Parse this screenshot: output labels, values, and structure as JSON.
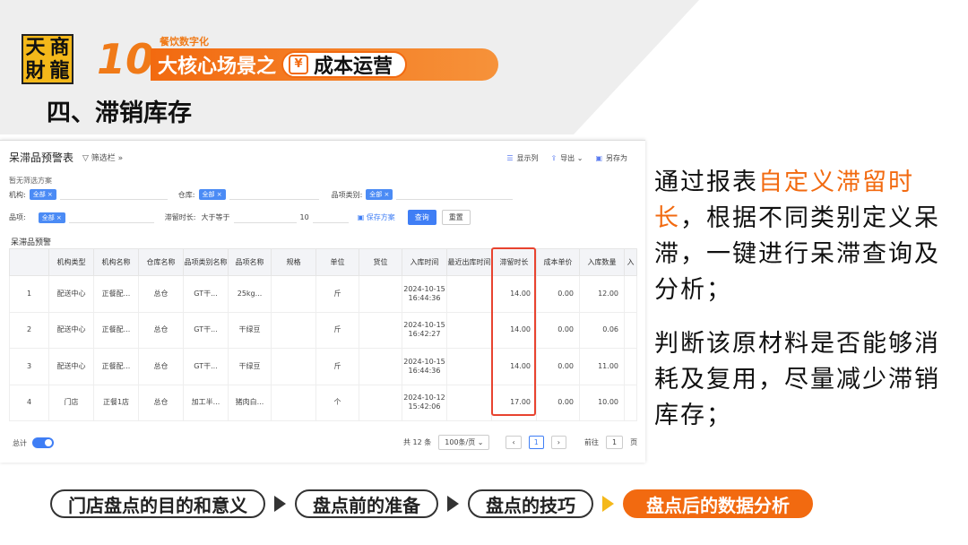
{
  "logo": {
    "chars": [
      "天",
      "商",
      "財",
      "龍"
    ]
  },
  "banner": {
    "number": "10",
    "subtitle": "餐饮数字化",
    "main_text": "大核心场景之",
    "pill_icon": "¥",
    "pill_text": "成本运营"
  },
  "section_title": "四、滞销库存",
  "app": {
    "title": "呆滞品预警表",
    "filter_toggle": "筛选栏",
    "actions": [
      {
        "icon": "columns-icon",
        "glyph": "☰",
        "label": "显示列"
      },
      {
        "icon": "export-icon",
        "glyph": "⇪",
        "label": "导出"
      },
      {
        "icon": "save-as-icon",
        "glyph": "▣",
        "label": "另存为"
      }
    ],
    "no_scheme": "暂无筛选方案",
    "filters": {
      "org_label": "机构:",
      "org_tag": "全部",
      "warehouse_label": "仓库:",
      "warehouse_tag": "全部",
      "category_label": "品项类别:",
      "category_tag": "全部",
      "item_label": "品项:",
      "item_tag": "全部",
      "duration_label": "滞留时长:",
      "duration_op": "大于等于",
      "duration_value": "10",
      "save_scheme": "保存方案",
      "query_button": "查询",
      "reset_button": "重置"
    },
    "grid_title": "呆滞品预警",
    "columns": [
      "",
      "机构类型",
      "机构名称",
      "仓库名称",
      "品项类别名称",
      "品项名称",
      "规格",
      "单位",
      "货位",
      "入库时间",
      "最近出库时间",
      "滞留时长",
      "成本单价",
      "入库数量",
      "入"
    ],
    "rows": [
      [
        "1",
        "配送中心",
        "正餐配...",
        "总仓",
        "GT干...",
        "25kg...",
        "",
        "斤",
        "",
        "2024-10-15 16:44:36",
        "",
        "14.00",
        "0.00",
        "12.00",
        ""
      ],
      [
        "2",
        "配送中心",
        "正餐配...",
        "总仓",
        "GT干...",
        "干绿豆",
        "",
        "斤",
        "",
        "2024-10-15 16:42:27",
        "",
        "14.00",
        "0.00",
        "0.06",
        ""
      ],
      [
        "3",
        "配送中心",
        "正餐配...",
        "总仓",
        "GT干...",
        "干绿豆",
        "",
        "斤",
        "",
        "2024-10-15 16:44:36",
        "",
        "14.00",
        "0.00",
        "11.00",
        ""
      ],
      [
        "4",
        "门店",
        "正餐1店",
        "总仓",
        "加工半...",
        "猪肉白...",
        "",
        "个",
        "",
        "2024-10-12 15:42:06",
        "",
        "17.00",
        "0.00",
        "10.00",
        ""
      ]
    ],
    "footer": {
      "total_label": "总计",
      "count_text": "共 12 条",
      "page_size": "100条/页",
      "current_page": "1",
      "goto_label": "前往",
      "goto_value": "1",
      "page_unit": "页"
    }
  },
  "right_text": {
    "p1_before": "通过报表",
    "p1_highlight": "自定义滞留时长",
    "p1_after": "，根据不同类别定义呆滞，一键进行呆滞查询及分析；",
    "p2": "判断该原材料是否能够消耗及复用，尽量减少滞销库存；"
  },
  "nav": {
    "items": [
      "门店盘点的目的和意义",
      "盘点前的准备",
      "盘点的技巧",
      "盘点后的数据分析"
    ]
  },
  "colors": {
    "accent": "#f26a10",
    "query_blue": "#3f7ef5",
    "highlight_red": "#e8432f"
  }
}
